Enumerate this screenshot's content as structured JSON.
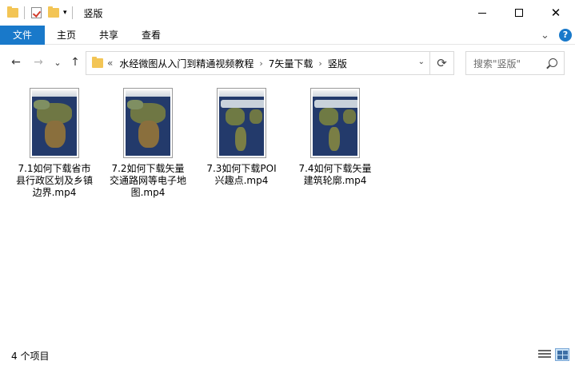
{
  "window": {
    "title": "竖版",
    "controls": {
      "minimize": "minimize",
      "maximize": "maximize",
      "close": "✕"
    }
  },
  "ribbon": {
    "tabs": [
      "文件",
      "主页",
      "共享",
      "查看"
    ],
    "expand_chevron": "⌄",
    "help": "?"
  },
  "nav": {
    "back": "←",
    "forward": "→",
    "recent": "⌄",
    "up": "↑"
  },
  "address": {
    "overflow": "«",
    "crumbs": [
      "水经微图从入门到精通视频教程",
      "7矢量下载",
      "竖版"
    ]
  },
  "search": {
    "placeholder": "搜索\"竖版\""
  },
  "files": [
    {
      "name": "7.1如何下载省市县行政区划及乡镇边界.mp4",
      "map": "africa"
    },
    {
      "name": "7.2如何下载矢量交通路网等电子地图.mp4",
      "map": "africa"
    },
    {
      "name": "7.3如何下载POI兴趣点.mp4",
      "map": "americas"
    },
    {
      "name": "7.4如何下载矢量建筑轮廓.mp4",
      "map": "americas"
    }
  ],
  "status": {
    "count": "4 个项目"
  },
  "colors": {
    "accent": "#1979ca",
    "folder": "#f3c555"
  }
}
